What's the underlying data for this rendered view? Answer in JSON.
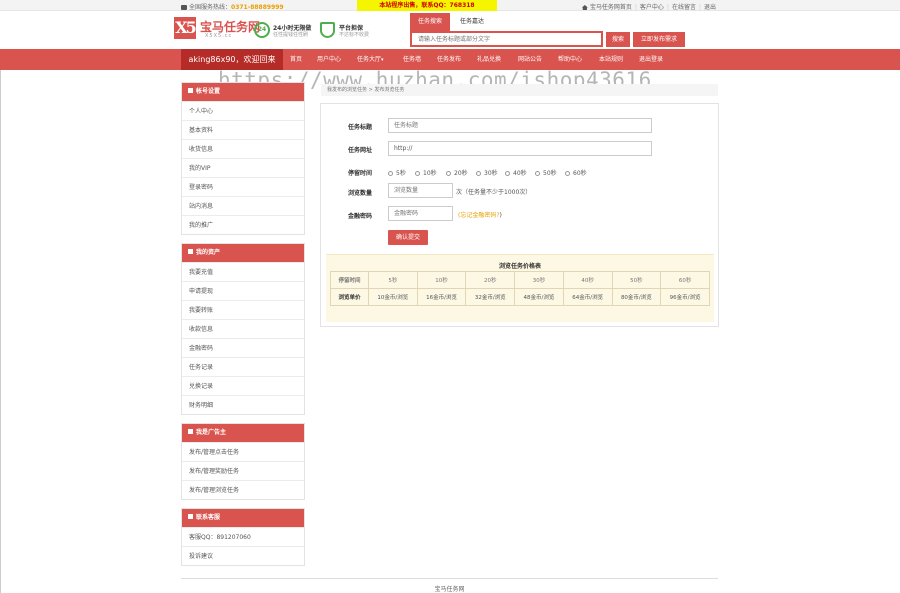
{
  "topbar": {
    "hotline_label": "全国服务热线：",
    "hotline_number": "0371-88889999",
    "notice": "本站程序出售，联系QQ：768318",
    "links": [
      "宝马任务网首页",
      "客户中心",
      "在线留言",
      "退出"
    ]
  },
  "header": {
    "logo_mark": "X5",
    "logo_name": "宝马任务网",
    "logo_sub": "X5X5.cc",
    "features": [
      {
        "badge": "24",
        "title": "24小时无限做",
        "desc": "任性提钱任性刷"
      },
      {
        "badge": "",
        "title": "平台担保",
        "desc": "不达标不收费"
      }
    ]
  },
  "search": {
    "tabs": [
      "任务搜索",
      "任务嘉达"
    ],
    "placeholder": "请输入任务标题或部分文字",
    "search_button": "搜索",
    "publish_button": "立即发布需求"
  },
  "nav": {
    "welcome": "aking86x90，欢迎回来",
    "items": [
      "首页",
      "用户中心",
      "任务大厅",
      "任务墙",
      "任务发布",
      "礼品兑换",
      "网站公告",
      "帮助中心",
      "本站规则",
      "退出登录"
    ]
  },
  "watermark": "https://www.huzhan.com/ishop43616",
  "sidebar": {
    "account": {
      "title": "帐号设置",
      "items": [
        "个人中心",
        "基本资料",
        "收货信息",
        "我的VIP",
        "登录密码",
        "站内消息",
        "我的推广"
      ]
    },
    "assets": {
      "title": "我的资产",
      "items": [
        "我要充值",
        "申请提现",
        "我要转账",
        "收款信息",
        "金融密码",
        "任务记录",
        "兑换记录",
        "财务明细"
      ]
    },
    "advertiser": {
      "title": "我是广告主",
      "items": [
        "发布/管理点击任务",
        "发布/管理奖励任务",
        "发布/管理浏览任务"
      ]
    },
    "contact": {
      "title": "联系客服",
      "items": [
        "客服QQ：891207060",
        "投诉建议"
      ]
    }
  },
  "breadcrumb": "我发布的浏览任务  >  发布浏览任务",
  "form": {
    "title_label": "任务标题",
    "title_placeholder": "任务标题",
    "url_label": "任务网址",
    "url_value": "http://",
    "time_label": "停留时间",
    "time_options": [
      "5秒",
      "10秒",
      "20秒",
      "30秒",
      "40秒",
      "50秒",
      "60秒"
    ],
    "count_label": "浏览数量",
    "count_placeholder": "浏览数量",
    "count_hint": "次（任务量不少于1000次）",
    "pwd_label": "金融密码",
    "pwd_placeholder": "金融密码",
    "pwd_hint_open": "(",
    "pwd_hint_link": "忘记金融密码?",
    "pwd_hint_close": ")",
    "submit": "确认提交"
  },
  "price_table": {
    "title": "浏览任务价格表",
    "row_headers": [
      "停留时间",
      "浏览单价"
    ],
    "times": [
      "5秒",
      "10秒",
      "20秒",
      "30秒",
      "40秒",
      "50秒",
      "60秒"
    ],
    "prices": [
      "10金币/浏览",
      "16金币/浏览",
      "32金币/浏览",
      "48金币/浏览",
      "64金币/浏览",
      "80金币/浏览",
      "96金币/浏览"
    ]
  },
  "footer": "宝马任务网"
}
